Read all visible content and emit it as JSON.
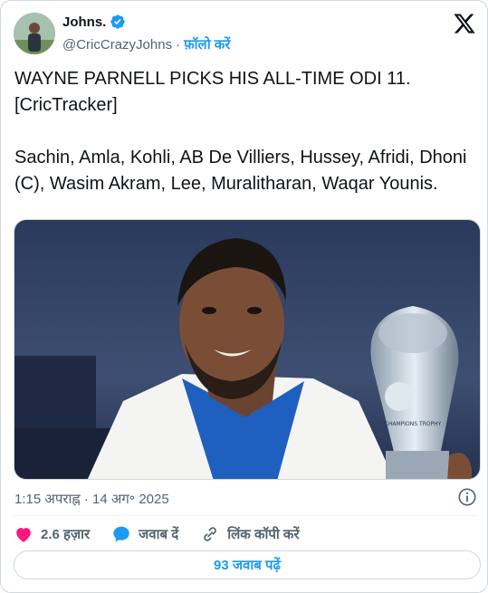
{
  "author": {
    "display_name": "Johns.",
    "handle": "@CricCrazyJohns",
    "separator": "·",
    "follow_label": "फ़ॉलो करें"
  },
  "tweet": {
    "text": "WAYNE PARNELL PICKS HIS ALL-TIME ODI 11. [CricTracker]\n\nSachin, Amla, Kohli, AB De Villiers, Hussey, Afridi, Dhoni (C), Wasim Akram, Lee, Muralitharan, Waqar Younis.",
    "trophy_text": "CHAMPIONS TROPHY"
  },
  "meta": {
    "timestamp": "1:15 अपराह्न · 14 अग॰ 2025"
  },
  "actions": {
    "like_count": "2.6 हज़ार",
    "reply_label": "जवाब दें",
    "copy_link_label": "लिंक कॉपी करें"
  },
  "replies_button": {
    "label": "93 जवाब पढ़ें"
  },
  "colors": {
    "accent": "#1d9bf0",
    "like": "#f91880",
    "muted": "#536471",
    "text": "#0f1419"
  },
  "icons": [
    "verified-badge-icon",
    "x-logo-icon",
    "info-icon",
    "heart-icon",
    "reply-bubble-icon",
    "link-icon"
  ]
}
